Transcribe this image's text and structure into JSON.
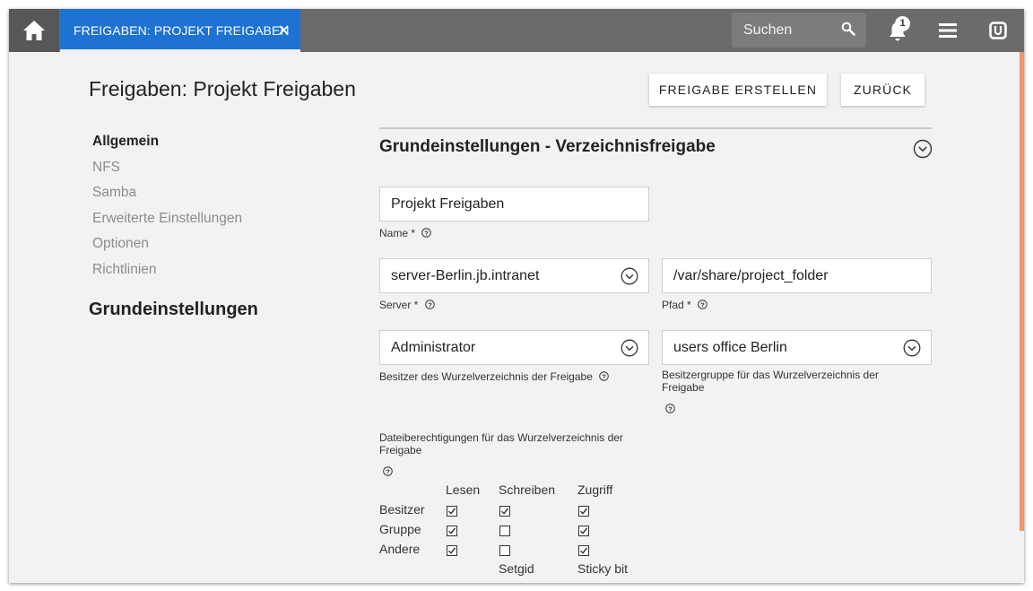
{
  "tab": {
    "label": "FREIGABEN: PROJEKT FREIGABEN"
  },
  "search": {
    "placeholder": "Suchen"
  },
  "notifications": {
    "count": "1"
  },
  "page": {
    "title": "Freigaben: Projekt Freigaben"
  },
  "actions": {
    "create_label": "FREIGABE ERSTELLEN",
    "back_label": "ZURÜCK"
  },
  "nav": {
    "items": [
      {
        "label": "Allgemein",
        "active": true
      },
      {
        "label": "NFS",
        "active": false
      },
      {
        "label": "Samba",
        "active": false
      },
      {
        "label": "Erweiterte Einstellungen",
        "active": false
      },
      {
        "label": "Optionen",
        "active": false
      },
      {
        "label": "Richtlinien",
        "active": false
      }
    ],
    "heading": "Grundeinstellungen"
  },
  "section": {
    "title": "Grundeinstellungen - Verzeichnisfreigabe"
  },
  "form": {
    "name": {
      "value": "Projekt Freigaben",
      "label": "Name *"
    },
    "server": {
      "value": "server-Berlin.jb.intranet",
      "label": "Server *"
    },
    "path": {
      "value": "/var/share/project_folder",
      "label": "Pfad *"
    },
    "owner": {
      "value": "Administrator",
      "label": "Besitzer des Wurzelverzeichnis der Freigabe"
    },
    "group": {
      "value": "users office Berlin",
      "label": "Besitzergruppe für das Wurzelverzeichnis der Freigabe"
    },
    "permissions": {
      "label": "Dateiberechtigungen für das Wurzelverzeichnis der Freigabe",
      "columns": [
        "Lesen",
        "Schreiben",
        "Zugriff"
      ],
      "rows": [
        {
          "label": "Besitzer",
          "checks": [
            true,
            true,
            true
          ]
        },
        {
          "label": "Gruppe",
          "checks": [
            true,
            false,
            true
          ]
        },
        {
          "label": "Andere",
          "checks": [
            true,
            false,
            true
          ]
        }
      ],
      "extra": [
        "Setgid",
        "Sticky bit"
      ]
    }
  },
  "colors": {
    "accent": "#1e72d2",
    "topbar": "#6b6b6b",
    "scroll_accent": "#f0936a"
  }
}
